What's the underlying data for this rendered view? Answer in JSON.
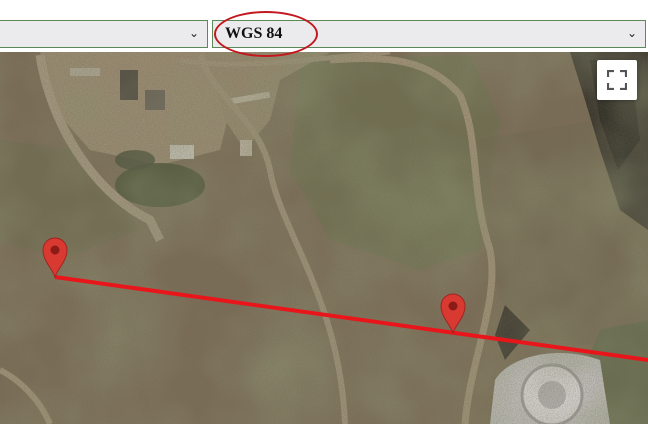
{
  "projection_selector": {
    "left_value": "",
    "right_value": "WGS 84"
  },
  "icons": {
    "dropdown": "chevron-down-icon",
    "fullscreen": "fullscreen-icon",
    "marker": "map-pin-icon"
  },
  "colors": {
    "measure_line": "#e8161b",
    "highlight_ellipse": "#c4181f",
    "marker_fill": "#d83a32"
  }
}
